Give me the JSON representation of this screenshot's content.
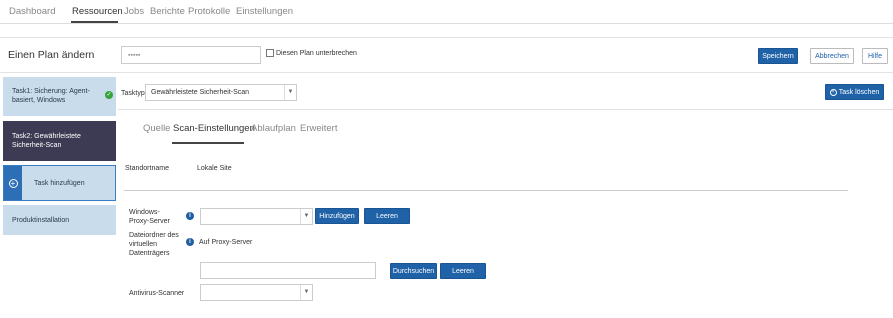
{
  "topnav": {
    "tabs": [
      {
        "label": "Dashboard"
      },
      {
        "label": "Ressourcen"
      },
      {
        "label": "Jobs"
      },
      {
        "label": "Berichte"
      },
      {
        "label": "Protokolle"
      },
      {
        "label": "Einstellungen"
      }
    ],
    "active_tab": "Ressourcen"
  },
  "header": {
    "title": "Einen Plan ändern",
    "plan_name_value": "▪▪▪▪▪",
    "pause_label": "Diesen Plan unterbrechen",
    "pause_checked": false,
    "save_label": "Speichern",
    "cancel_label": "Abbrechen",
    "help_label": "Hilfe"
  },
  "sidebar": {
    "items": [
      {
        "label": "Task1: Sicherung: Agent-basiert, Windows",
        "status_icon": "check-icon"
      },
      {
        "label": "Task2: Gewährleistete Sicherheit-Scan"
      },
      {
        "label": "Task hinzufügen",
        "icon": "add-icon"
      },
      {
        "label": "Produktinstallation"
      }
    ]
  },
  "main": {
    "tasktype_label": "Tasktyp",
    "tasktype_value": "Gewährleistete Sicherheit-Scan",
    "delete_task_label": "Task löschen",
    "subtabs": [
      {
        "label": "Quelle"
      },
      {
        "label": "Scan-Einstellungen"
      },
      {
        "label": "Ablaufplan"
      },
      {
        "label": "Erweitert"
      }
    ],
    "active_subtab": "Scan-Einstellungen",
    "site_name_label": "Standortname",
    "site_name_value": "Lokale Site",
    "proxy_label": "Windows-Proxy-Server",
    "proxy_value": "",
    "add_button": "Hinzufügen",
    "clear_button": "Leeren",
    "vd_folder_label": "Dateiordner des virtuellen Datenträgers",
    "vd_folder_note": "Auf Proxy-Server",
    "vd_folder_value": "",
    "browse_button": "Durchsuchen",
    "clear_button_2": "Leeren",
    "antivirus_label": "Antivirus-Scanner",
    "antivirus_value": ""
  },
  "colors": {
    "primary": "#1f62a8",
    "sidebar_light": "#c9dcec",
    "sidebar_dark": "#3c3b53",
    "success": "#36a33b"
  }
}
